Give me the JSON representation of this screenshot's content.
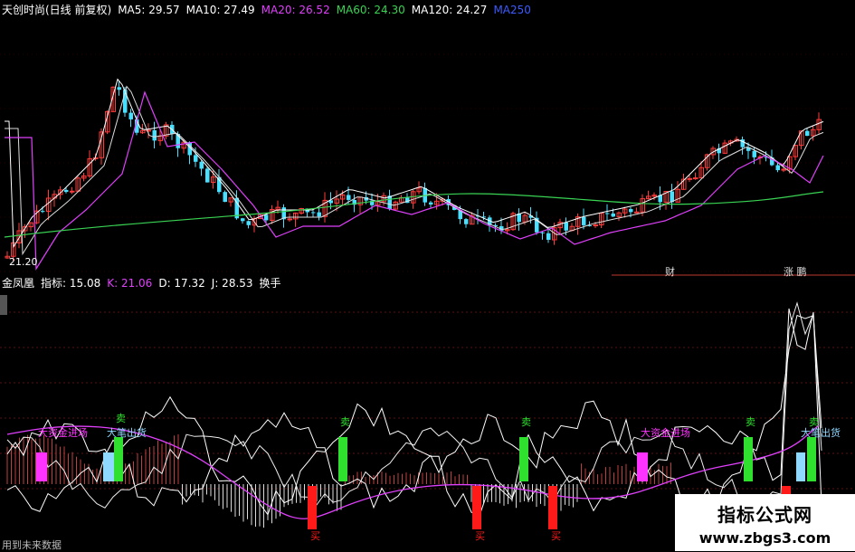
{
  "header": {
    "title": "天创时尚(日线 前复权)",
    "ma": [
      {
        "label": "MA5: 29.57",
        "color": "#ffffff"
      },
      {
        "label": "MA10: 27.49",
        "color": "#ffffff"
      },
      {
        "label": "MA20: 26.52",
        "color": "#e040fb"
      },
      {
        "label": "MA60: 24.30",
        "color": "#39d353"
      },
      {
        "label": "MA120: 24.27",
        "color": "#ffffff"
      },
      {
        "label": "MA250",
        "color": "#3d5afe"
      }
    ]
  },
  "price_panel": {
    "low_label": "21.20",
    "side_labels": [
      "财",
      "涨 鹏"
    ]
  },
  "indicator_header": {
    "name": "金凤凰",
    "items": [
      {
        "label": "指标: 15.08",
        "color": "#ffffff"
      },
      {
        "label": "K: 21.06",
        "color": "#e040fb"
      },
      {
        "label": "D: 17.32",
        "color": "#ffffff"
      },
      {
        "label": "J: 28.53",
        "color": "#ffffff"
      },
      {
        "label": "换手",
        "color": "#ffffff"
      }
    ]
  },
  "signals": {
    "sell": "卖",
    "buy": "买",
    "capital_in": "大资金进场",
    "big_out": "大笔出货"
  },
  "footer": "用到未来数据",
  "watermark": {
    "title": "指标公式网",
    "url": "www.zbgs3.com"
  },
  "colors": {
    "up": "#ff3b3b",
    "down": "#49e0ff",
    "ma20": "#e040fb",
    "ma60": "#39d353",
    "sell_bar": "#2fe02f",
    "buy_bar": "#ff1a1a",
    "capital_bar": "#ff33ff",
    "out_bar": "#8fd8ff"
  }
}
